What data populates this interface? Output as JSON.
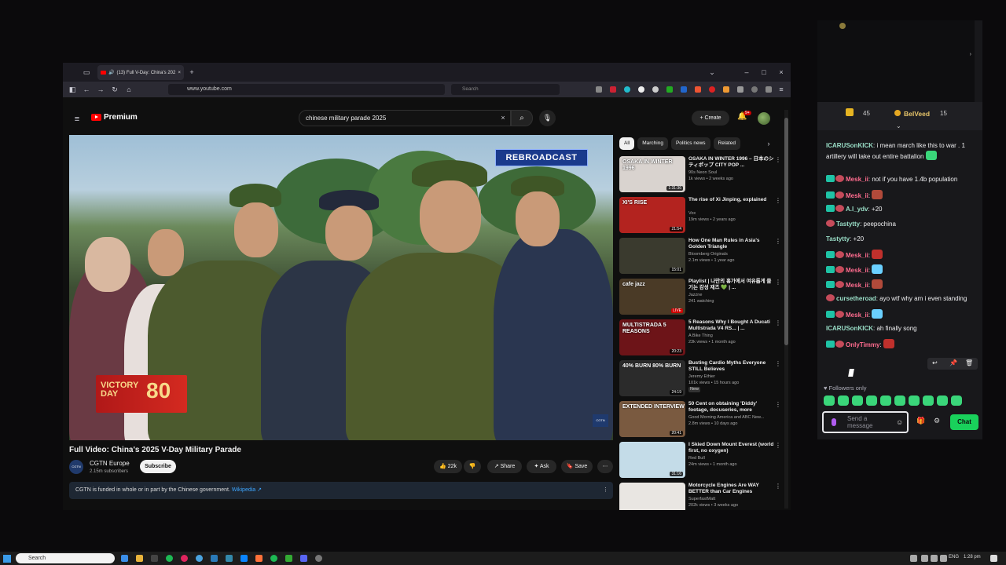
{
  "browser": {
    "tab_title": "(13) Full V-Day: China's 202",
    "url": "www.youtube.com",
    "search_placeholder": "Search"
  },
  "youtube": {
    "logo_text": "Premium",
    "search_query": "chinese military parade 2025",
    "create_label": "Create",
    "notif_count": "9+",
    "video": {
      "overlay_label": "REBROADCAST",
      "victory_text": "VICTORY",
      "victory_day": "DAY",
      "victory_number": "80",
      "logo_text": "CGTN",
      "title": "Full Video: China's 2025 V-Day Military Parade",
      "channel": "CGTN Europe",
      "subscribers": "2.15m subscribers",
      "subscribe_label": "Subscribe",
      "likes": "22k",
      "share_label": "Share",
      "ask_label": "Ask",
      "save_label": "Save",
      "notice_text": "CGTN is funded in whole or in part by the Chinese government.",
      "notice_link": "Wikipedia"
    },
    "chips": [
      "All",
      "Marching",
      "Politics news",
      "Related"
    ],
    "recommendations": [
      {
        "title": "OSAKA IN WINTER 1996 – 日本のシティポップ CITY POP ...",
        "channel": "90s Neon Soul",
        "meta": "1k views • 2 weeks ago",
        "duration": "1:31:36",
        "thumb_label": "OSAKA IN WINTER 1996",
        "color": "#d9d3cf"
      },
      {
        "title": "The rise of Xi Jinping, explained",
        "channel": "Vox",
        "meta": "19m views • 2 years ago",
        "duration": "21:54",
        "thumb_label": "XI'S RISE",
        "color": "#b3231f"
      },
      {
        "title": "How One Man Rules in Asia's Golden Triangle",
        "channel": "Bloomberg Originals",
        "meta": "2.1m views • 1 year ago",
        "duration": "15:01",
        "thumb_label": "",
        "color": "#3a3a2e"
      },
      {
        "title": "Playlist | 나만의 흉가에서 여유롭게 즐기는 감성 재즈 💚 | ...",
        "channel": "Jazzne",
        "meta": "241 watching",
        "duration": "LIVE",
        "thumb_label": "cafe jazz",
        "color": "#4a3a26"
      },
      {
        "title": "5 Reasons Why I Bought A Ducati Multistrada V4 RS... | ...",
        "channel": "A Bike Thing",
        "meta": "23k views • 1 month ago",
        "duration": "20:23",
        "thumb_label": "MULTISTRADA 5 REASONS",
        "color": "#6d1418"
      },
      {
        "title": "Busting Cardio Myths Everyone STILL Believes",
        "channel": "Jeremy Ethier",
        "meta": "101k views • 15 hours ago",
        "duration": "24:19",
        "badge": "New",
        "thumb_label": "40% BURN 80% BURN",
        "color": "#2b2b2b"
      },
      {
        "title": "50 Cent on obtaining 'Diddy' footage, docuseries, more",
        "channel": "Good Morning America",
        "meta": "2.8m views • 10 days ago",
        "duration": "20:41",
        "channel_extra": "and ABC New...",
        "thumb_label": "EXTENDED INTERVIEW",
        "color": "#7a5a40"
      },
      {
        "title": "I Skied Down Mount Everest (world first, no oxygen)",
        "channel": "Red Bull",
        "meta": "24m views • 1 month ago",
        "duration": "31:16",
        "thumb_label": "",
        "color": "#c4dce8"
      },
      {
        "title": "Motorcycle Engines Are WAY BETTER than Car Engines",
        "channel": "SuperfastMatt",
        "meta": "202k views • 3 weeks ago",
        "duration": "",
        "thumb_label": "",
        "color": "#e9e6e2"
      }
    ]
  },
  "chat": {
    "top_user_left_count": "45",
    "top_user_right": "BeIVeed",
    "top_user_right_count": "15",
    "messages": [
      {
        "user": "ICARUSonKICK",
        "text": "i mean march like this to war . 1 artillery will take out entire battalion",
        "style": "u1",
        "badges": 0,
        "emote": true
      },
      {
        "user": "Mesk_ii",
        "text": "not if you have 1.4b population",
        "style": "u2",
        "badges": 2
      },
      {
        "user": "Mesk_ii",
        "text": "",
        "style": "u2",
        "badges": 2,
        "emote": true
      },
      {
        "user": "A.l_ydv",
        "text": "+20",
        "style": "u1",
        "badges": 2
      },
      {
        "user": "Tastytty",
        "text": "peepochina",
        "style": "u1",
        "badges": 1
      },
      {
        "user": "Tastytty",
        "text": "+20",
        "style": "u1",
        "badges": 0
      },
      {
        "user": "Mesk_ii",
        "text": "",
        "style": "u2",
        "badges": 2,
        "emote": true
      },
      {
        "user": "Mesk_ii",
        "text": "",
        "style": "u2",
        "badges": 2,
        "emote": true
      },
      {
        "user": "Mesk_ii",
        "text": "",
        "style": "u2",
        "badges": 2,
        "emote": true
      },
      {
        "user": "cursetheroad",
        "text": "ayo wtf why am i even standing",
        "style": "u1",
        "badges": 1
      },
      {
        "user": "Mesk_ii",
        "text": "",
        "style": "u2",
        "badges": 2,
        "emote": true
      },
      {
        "user": "ICARUSonKICK",
        "text": "ah finally song",
        "style": "u1",
        "badges": 0
      },
      {
        "user": "OnlyTimmy",
        "text": "",
        "style": "u2",
        "badges": 2,
        "emote": true
      }
    ],
    "followers_only": "Followers only",
    "input_placeholder": "Send a message",
    "chat_button": "Chat"
  },
  "taskbar": {
    "search_placeholder": "Search",
    "language": "ENG",
    "time": "1:28 pm"
  }
}
